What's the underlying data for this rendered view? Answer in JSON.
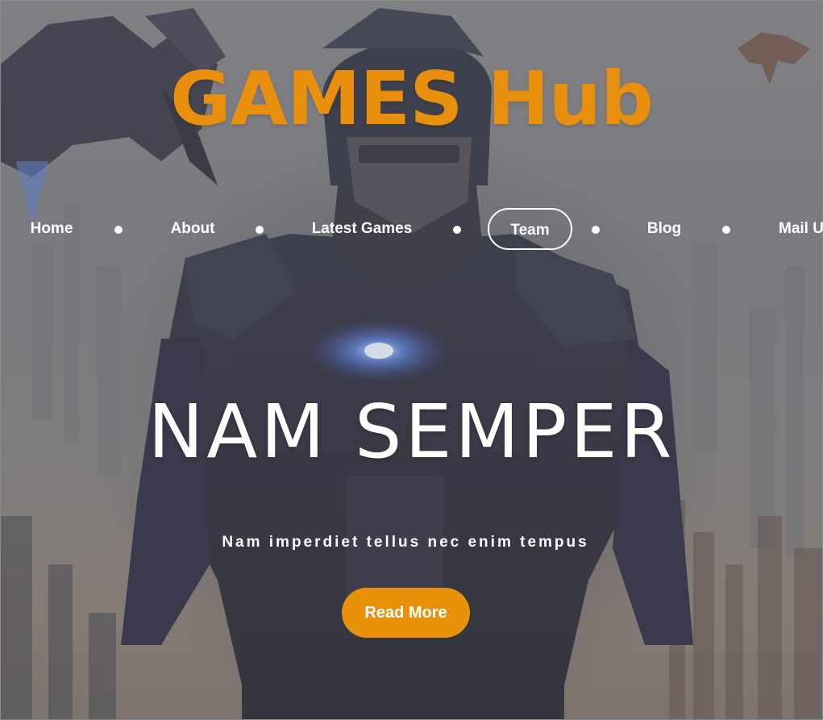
{
  "header": {
    "site_title": "GAMES Hub"
  },
  "nav": {
    "items": [
      {
        "label": "Home",
        "active": false
      },
      {
        "label": "About",
        "active": false
      },
      {
        "label": "Latest Games",
        "active": false
      },
      {
        "label": "Team",
        "active": true
      },
      {
        "label": "Blog",
        "active": false
      },
      {
        "label": "Mail Us",
        "active": false
      }
    ]
  },
  "hero": {
    "headline": "NAM SEMPER",
    "subheadline": "Nam imperdiet tellus nec enim tempus",
    "cta_label": "Read More"
  },
  "colors": {
    "accent": "#e8900d",
    "button": "#e8920b",
    "text": "#ffffff"
  }
}
